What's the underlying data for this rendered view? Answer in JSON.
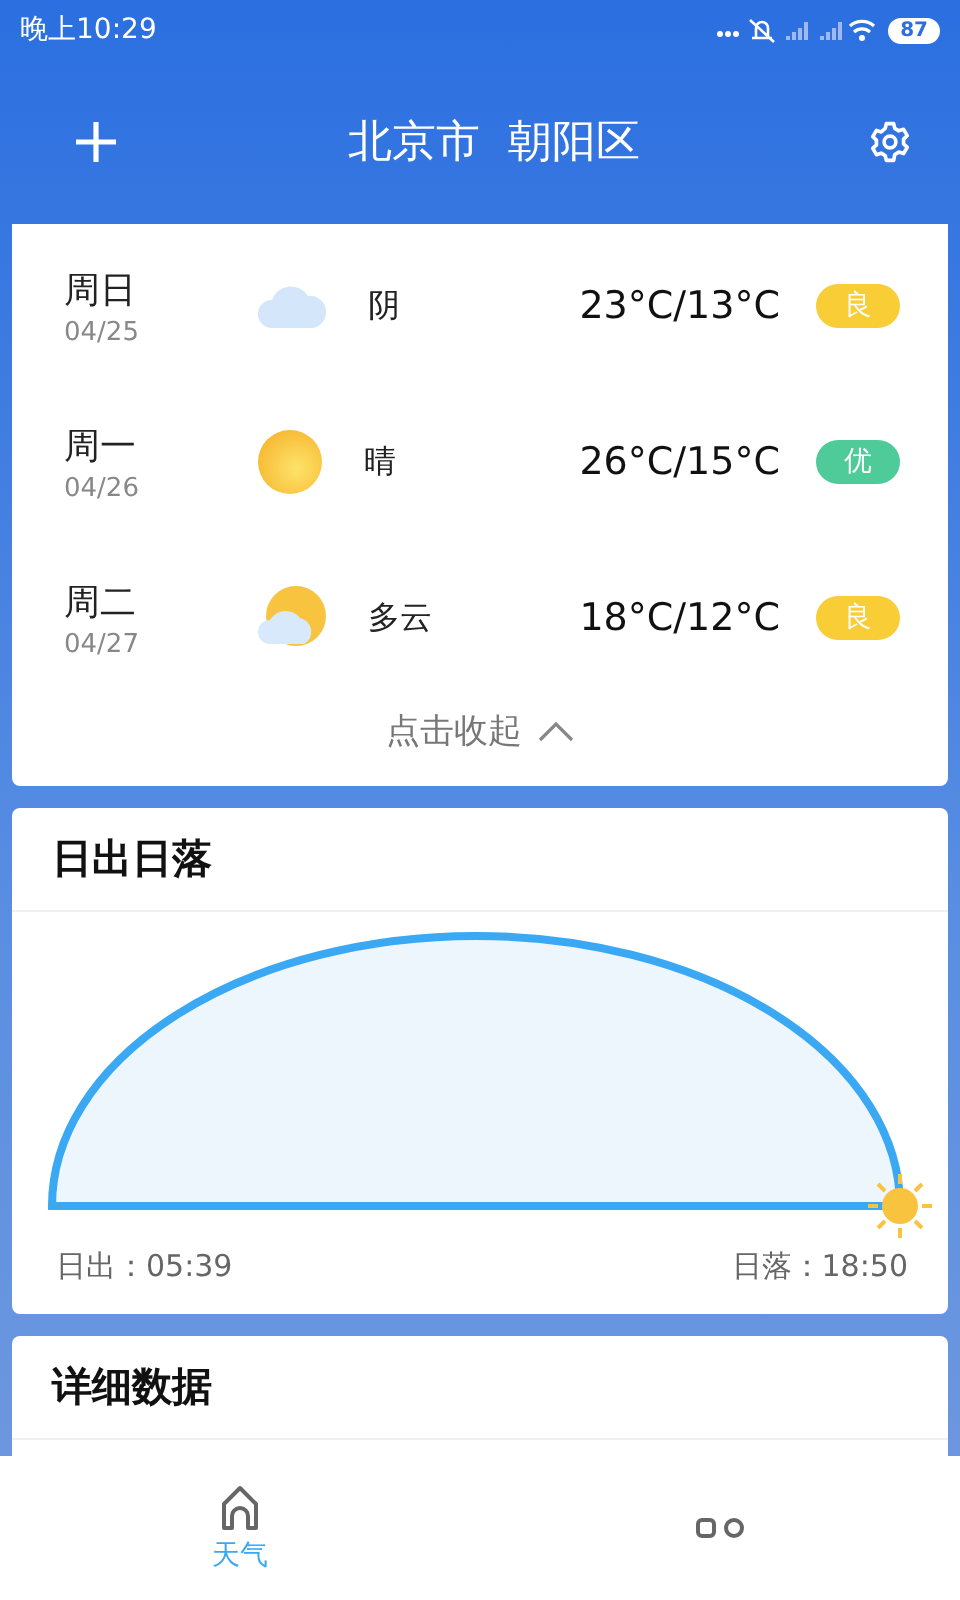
{
  "status_bar": {
    "time": "晚上10:29",
    "battery": "87"
  },
  "header": {
    "title": "北京市  朝阳区"
  },
  "forecast": [
    {
      "day": "周日",
      "date": "04/25",
      "kind": "cloudy",
      "weather": "阴",
      "temp": "23°C/13°C",
      "aqi": "良",
      "color": "#f8cd35"
    },
    {
      "day": "周一",
      "date": "04/26",
      "kind": "sunny",
      "weather": "晴",
      "temp": "26°C/15°C",
      "aqi": "优",
      "color": "#4ecb98"
    },
    {
      "day": "周二",
      "date": "04/27",
      "kind": "partly_cloudy",
      "weather": "多云",
      "temp": "18°C/12°C",
      "aqi": "良",
      "color": "#f8cd35"
    }
  ],
  "collapse_link": "点击收起",
  "sun": {
    "title": "日出日落",
    "sunrise": "日出：05:39",
    "sunset": "日落：18:50",
    "level": 1
  },
  "details": {
    "title": "详细数据"
  },
  "tabs": [
    {
      "label": "天气",
      "selected": true
    },
    {
      "kind": "grid",
      "selected": false
    }
  ]
}
